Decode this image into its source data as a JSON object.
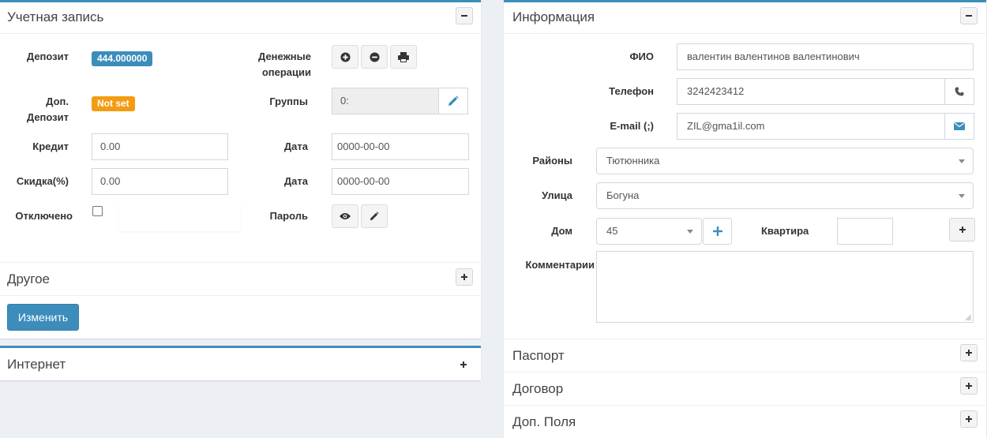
{
  "account": {
    "title": "Учетная запись",
    "deposit_label": "Депозит",
    "deposit_value": "444.000000",
    "money_ops_label": "Денежные операции",
    "extra_deposit_label": "Доп. Депозит",
    "extra_deposit_value": "Not set",
    "groups_label": "Группы",
    "groups_value": "0:",
    "credit_label": "Кредит",
    "credit_value": "0.00",
    "credit_date_label": "Дата",
    "credit_date_value": "0000-00-00",
    "discount_label": "Скидка(%)",
    "discount_value": "0.00",
    "discount_date_label": "Дата",
    "discount_date_value": "0000-00-00",
    "disabled_label": "Отключено",
    "disabled_checked": false,
    "password_label": "Пароль",
    "other_title": "Другое",
    "change_button": "Изменить"
  },
  "internet": {
    "title": "Интернет"
  },
  "info": {
    "title": "Информация",
    "fio_label": "ФИО",
    "fio_value": "валентин валентинов валентинович",
    "phone_label": "Телефон",
    "phone_value": "3242423412",
    "email_label": "E-mail (;)",
    "email_value": "ZIL@gma1il.com",
    "district_label": "Районы",
    "district_value": "Тютюнника",
    "street_label": "Улица",
    "street_value": "Богуна",
    "house_label": "Дом",
    "house_value": "45",
    "apartment_label": "Квартира",
    "apartment_value": "",
    "comments_label": "Комментарии",
    "comments_value": ""
  },
  "collapsed_sections": [
    "Паспорт",
    "Договор",
    "Доп. Поля"
  ],
  "colors": {
    "primary": "#3c8dbc",
    "badge_blue": "#3c8dbc",
    "badge_orange": "#f39c12",
    "background": "#ecf0f5"
  }
}
